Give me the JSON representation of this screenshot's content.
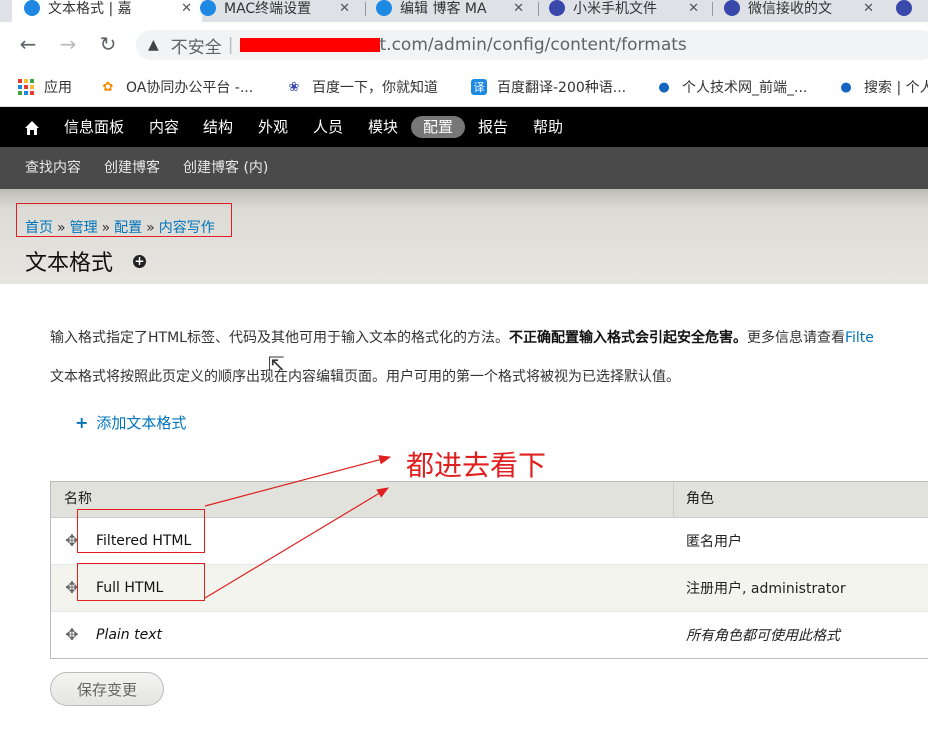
{
  "browser": {
    "tabs": [
      {
        "label": "文本格式 | 嘉",
        "close": "✕",
        "color": "#1e88e5"
      },
      {
        "label": "MAC终端设置",
        "close": "✕",
        "color": "#1e88e5"
      },
      {
        "label": "编辑 博客 MA",
        "close": "✕",
        "color": "#1e88e5"
      },
      {
        "label": "小米手机文件",
        "close": "✕",
        "color": "#3949ab"
      },
      {
        "label": "微信接收的文",
        "close": "✕",
        "color": "#3949ab"
      }
    ],
    "address": {
      "not_secure": "不安全",
      "separator": "|",
      "url_visible": "t.com/admin/config/content/formats"
    },
    "bookmarks": [
      {
        "label": "应用",
        "icon": "apps-grid-icon"
      },
      {
        "label": "OA协同办公平台 -...",
        "icon": "oa-flower-icon"
      },
      {
        "label": "百度一下，你就知道",
        "icon": "baidu-paw-icon"
      },
      {
        "label": "百度翻译-200种语...",
        "icon": "translate-icon",
        "glyph": "译"
      },
      {
        "label": "个人技术网_前端_...",
        "icon": "drupal-drop-icon"
      },
      {
        "label": "搜索 | 个人",
        "icon": "drupal-drop-icon"
      }
    ]
  },
  "admin": {
    "home_icon": "home-icon",
    "menu": [
      "信息面板",
      "内容",
      "结构",
      "外观",
      "人员",
      "模块",
      "配置",
      "报告",
      "帮助"
    ],
    "active_item": "配置",
    "shortcuts": [
      "查找内容",
      "创建博客",
      "创建博客 (内)"
    ]
  },
  "breadcrumb": {
    "items": [
      "首页",
      "管理",
      "配置",
      "内容写作"
    ],
    "separator": "»"
  },
  "page": {
    "title": "文本格式",
    "desc1_prefix": "输入格式指定了HTML标签、代码及其他可用于输入文本的格式化的方法。",
    "desc1_bold": "不正确配置输入格式会引起安全危害。",
    "desc1_suffix": "更多信息请查看",
    "desc1_link": "Filte",
    "desc2": "文本格式将按照此页定义的顺序出现在内容编辑页面。用户可用的第一个格式将被视为已选择默认值。",
    "add_link": "添加文本格式",
    "annotation": "都进去看下"
  },
  "table": {
    "headers": [
      "名称",
      "角色"
    ],
    "rows": [
      {
        "name": "Filtered HTML",
        "roles": "匿名用户",
        "italic": false
      },
      {
        "name": "Full HTML",
        "roles": "注册用户, administrator",
        "italic": false
      },
      {
        "name": "Plain text",
        "roles": "所有角色都可使用此格式",
        "italic": true
      }
    ]
  },
  "save_button": "保存变更",
  "colors": {
    "annotation_red": "#e02020",
    "link_blue": "#0074bd",
    "admin_bar": "#000000"
  }
}
